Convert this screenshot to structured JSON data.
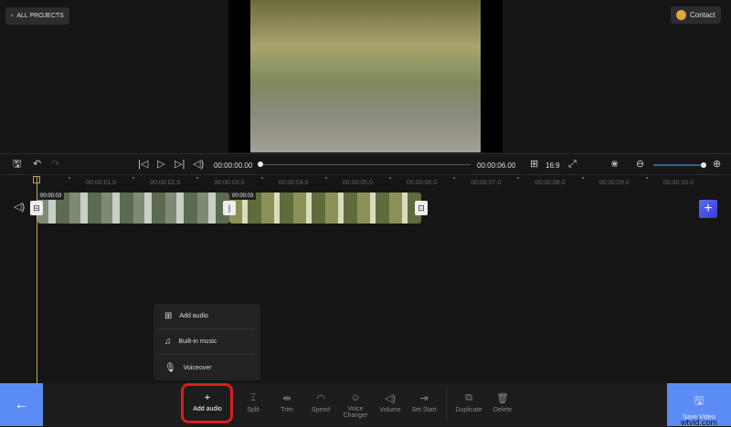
{
  "header": {
    "back_label": "ALL PROJECTS",
    "contact_label": "Contact"
  },
  "player": {
    "current_time": "00:00:00.00",
    "total_time": "00:00:06.00",
    "aspect_ratio": "16:9",
    "progress": 0
  },
  "zoom": {
    "level": 0.95
  },
  "ruler": {
    "ticks": [
      "00:00:01.0",
      "00:00:02.0",
      "00:00:03.0",
      "00:00:04.0",
      "00:00:05.0",
      "00:00:06.0",
      "00:00:07.0",
      "00:00:08.0",
      "00:00:09.0",
      "00:00:10.0"
    ]
  },
  "clips": [
    {
      "duration": "00:00:03"
    },
    {
      "duration": "00:00:03"
    }
  ],
  "popup": {
    "items": [
      {
        "label": "Add audio",
        "icon": "file-plus-icon"
      },
      {
        "label": "Built-in music",
        "icon": "music-icon"
      },
      {
        "label": "Voiceover",
        "icon": "microphone-icon"
      }
    ]
  },
  "tools": [
    {
      "label": "Add audio",
      "icon": "+"
    },
    {
      "label": "Split",
      "icon": "⌶"
    },
    {
      "label": "Trim",
      "icon": "⇹"
    },
    {
      "label": "Speed",
      "icon": "◠"
    },
    {
      "label": "Voice Changer",
      "icon": "☺"
    },
    {
      "label": "Volume",
      "icon": "◁)"
    },
    {
      "label": "Set Start",
      "icon": "⇥"
    },
    {
      "label": "Duplicate",
      "icon": "⧉"
    },
    {
      "label": "Delete",
      "icon": "🗑"
    }
  ],
  "save_label": "Save Video",
  "watermark": "wtvid.com",
  "colors": {
    "accent": "#5b8cf5",
    "highlight": "#d81e1e",
    "playhead": "#c9a24a"
  }
}
